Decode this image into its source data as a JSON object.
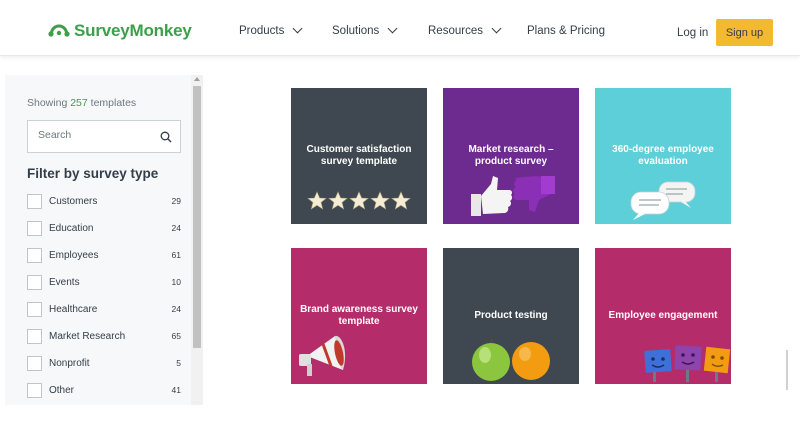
{
  "brand": {
    "name": "SurveyMonkey",
    "color": "#3ca04a"
  },
  "nav": {
    "items": [
      {
        "label": "Products",
        "dropdown": true
      },
      {
        "label": "Solutions",
        "dropdown": true
      },
      {
        "label": "Resources",
        "dropdown": true
      },
      {
        "label": "Plans & Pricing",
        "dropdown": false
      }
    ],
    "login": "Log in",
    "signup": "Sign up"
  },
  "sidebar": {
    "showing_prefix": "Showing",
    "showing_count": "257",
    "showing_suffix": "templates",
    "search_placeholder": "Search",
    "filter_title": "Filter by survey type",
    "filters": [
      {
        "label": "Customers",
        "count": "29"
      },
      {
        "label": "Education",
        "count": "24"
      },
      {
        "label": "Employees",
        "count": "61"
      },
      {
        "label": "Events",
        "count": "10"
      },
      {
        "label": "Healthcare",
        "count": "24"
      },
      {
        "label": "Market Research",
        "count": "65"
      },
      {
        "label": "Nonprofit",
        "count": "5"
      },
      {
        "label": "Other",
        "count": "41"
      }
    ]
  },
  "templates": [
    {
      "title": "Customer satisfaction survey template",
      "color": "#3f4850",
      "icon": "five-stars-icon"
    },
    {
      "title": "Market research – product survey",
      "color": "#6e2b8f",
      "icon": "thumbs-up-down-icon"
    },
    {
      "title": "360-degree employee evaluation",
      "color": "#5dcfd8",
      "icon": "speech-bubbles-icon"
    },
    {
      "title": "Brand awareness survey template",
      "color": "#b52c6a",
      "icon": "megaphone-icon"
    },
    {
      "title": "Product testing",
      "color": "#3f4850",
      "icon": "apple-orange-icon"
    },
    {
      "title": "Employee engagement",
      "color": "#b52c6a",
      "icon": "sticky-note-faces-icon"
    }
  ],
  "colors": {
    "accent": "#f2b931",
    "text": "#333e48",
    "muted": "#6b787f"
  }
}
